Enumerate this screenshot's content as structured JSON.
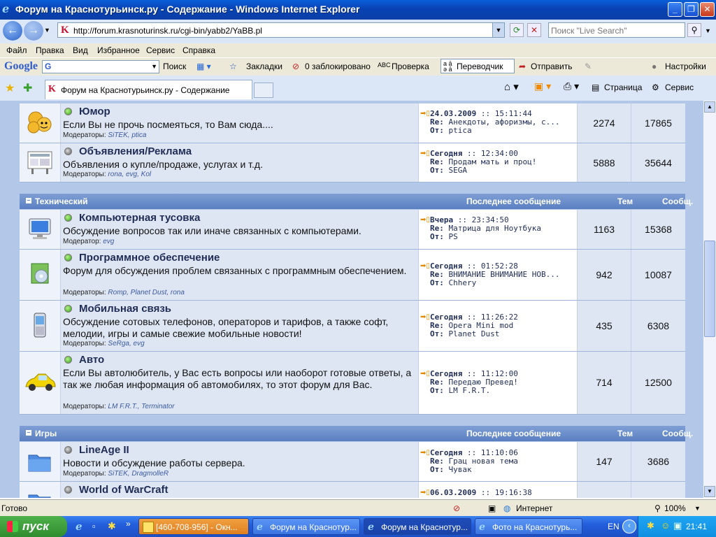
{
  "window": {
    "title": "Форум на Краснотурьинск.ру - Содержание - Windows Internet Explorer"
  },
  "address": {
    "url": "http://forum.krasnoturinsk.ru/cgi-bin/yabb2/YaBB.pl"
  },
  "search": {
    "placeholder": "Поиск \"Live Search\""
  },
  "menu": [
    "Файл",
    "Правка",
    "Вид",
    "Избранное",
    "Сервис",
    "Справка"
  ],
  "gbar": {
    "logo": "Google",
    "search": "Поиск",
    "bookmarks": "Закладки",
    "blocked": "0 заблокировано",
    "check": "Проверка",
    "translator": "Переводчик",
    "send": "Отправить",
    "settings": "Настройки"
  },
  "tab": {
    "title": "Форум на Краснотурьинск.ру - Содержание"
  },
  "tabtools": {
    "page": "Страница",
    "service": "Сервис"
  },
  "headers": {
    "last": "Последнее сообщение",
    "topics": "Тем",
    "posts": "Сообщ."
  },
  "labels": {
    "re": "Re:",
    "by": "От:"
  },
  "top_rows": [
    {
      "name": "Юмор",
      "desc": "Если Вы не прочь посмеяться, то Вам сюда....",
      "mod_label": "Модераторы:",
      "mods": "SiTEK, ptica",
      "last_date": "24.03.2009",
      "last_time": "15:11:44",
      "last_subj": "Анекдоты, афоризмы, с...",
      "last_from": "ptica",
      "topics": "2274",
      "posts": "17865",
      "online": true
    },
    {
      "name": "Объявления/Реклама",
      "desc": "Объявления о купле/продаже, услугах и т.д.",
      "mod_label": "Модераторы:",
      "mods": "rona, evg, Kol",
      "last_date": "Сегодня",
      "last_time": "12:34:00",
      "last_subj": "Продам мать и проц!",
      "last_from": "SEGA",
      "topics": "5888",
      "posts": "35644",
      "online": false
    }
  ],
  "categories": [
    {
      "name": "Технический",
      "rows": [
        {
          "name": "Компьютерная тусовка",
          "desc": "Обсуждение вопросов так или иначе связанных с компьютерами.",
          "mod_label": "Модератор:",
          "mods": "evg",
          "last_date": "Вчера",
          "last_time": "23:34:50",
          "last_subj": "Матрица для Ноутбука",
          "last_from": "PS",
          "topics": "1163",
          "posts": "15368",
          "online": true
        },
        {
          "name": "Программное обеспечение",
          "desc": "Форум для обсуждения проблем связанных с программным обеспечением.",
          "mod_label": "Модераторы:",
          "mods": "Romp, Planet Dust, rona",
          "last_date": "Сегодня",
          "last_time": "01:52:28",
          "last_subj": "ВНИМАНИЕ ВНИМАНИЕ НОВ...",
          "last_from": "Chhery",
          "topics": "942",
          "posts": "10087",
          "online": true
        },
        {
          "name": "Мобильная связь",
          "desc": "Обсуждение сотовых телефонов, операторов и тарифов, а также софт, мелодии, игры и самые свежие мобильные новости!",
          "mod_label": "Модераторы:",
          "mods": "SeRga, evg",
          "last_date": "Сегодня",
          "last_time": "11:26:22",
          "last_subj": "Opera Mini mod",
          "last_from": "Planet Dust",
          "topics": "435",
          "posts": "6308",
          "online": true
        },
        {
          "name": "Авто",
          "desc": "Если Вы автолюбитель, у Вас есть вопросы или наоборот готовые ответы, а так же любая информация об автомобилях, то этот форум для Вас.",
          "mod_label": "Модераторы:",
          "mods": "LM F.R.T., Terminator",
          "last_date": "Сегодня",
          "last_time": "11:12:00",
          "last_subj": "Передаю Превед!",
          "last_from": "LM F.R.T.",
          "topics": "714",
          "posts": "12500",
          "online": true
        }
      ]
    },
    {
      "name": "Игры",
      "rows": [
        {
          "name": "LineAge II",
          "desc": "Новости и обсуждение работы сервера.",
          "mod_label": "Модераторы:",
          "mods": "SiTEK, DragmolleR",
          "last_date": "Сегодня",
          "last_time": "11:10:06",
          "last_subj": "Грац новая тема",
          "last_from": "Чувак",
          "topics": "147",
          "posts": "3686",
          "online": false
        },
        {
          "name": "World of WarCraft",
          "desc": "",
          "mod_label": "",
          "mods": "",
          "last_date": "06.03.2009",
          "last_time": "19:16:38",
          "last_subj": "",
          "last_from": "",
          "topics": "",
          "posts": "",
          "online": false
        }
      ]
    }
  ],
  "status": {
    "text": "Готово",
    "zone": "Интернет",
    "zoom": "100%"
  },
  "taskbar": {
    "start": "пуск",
    "tasks": [
      "[460-708-956] - Окн...",
      "Форум на Краснотур...",
      "Форум на Краснотур...",
      "Фото на Краснотурь..."
    ],
    "lang": "EN",
    "clock": "21:41"
  }
}
